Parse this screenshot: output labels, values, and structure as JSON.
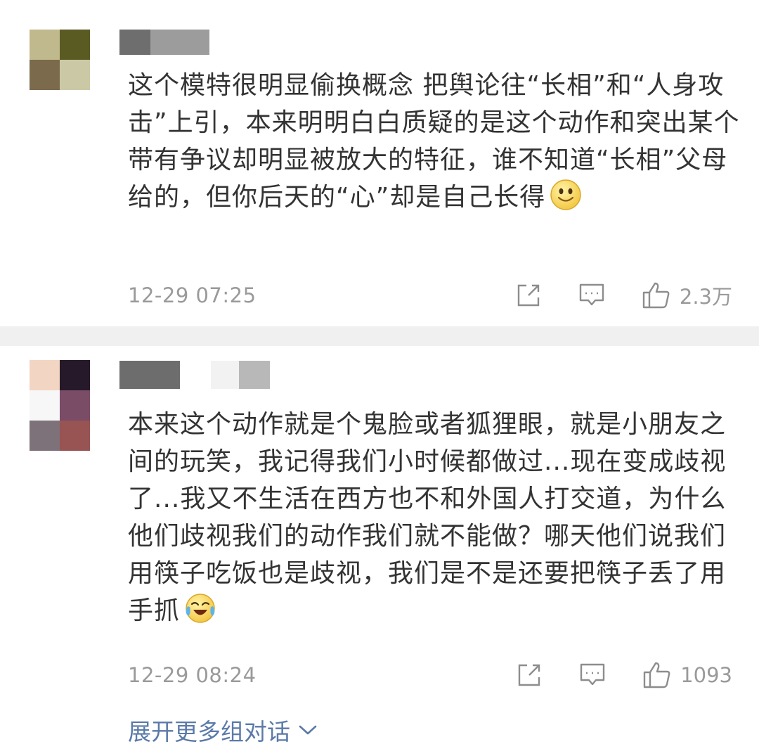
{
  "comments": [
    {
      "avatar_colors": [
        "#c1b98e",
        "#5a5a23",
        "#7b6a4c",
        "#cbc8a6"
      ],
      "name_colors": [
        "#6e6e6e",
        "#9c9c9c",
        "#ffffff",
        "#ffffff"
      ],
      "text": "这个模特很明显偷换概念 把舆论往“长相”和“人身攻击”上引，本来明明白白质疑的是这个动作和突出某个带有争议却明显被放大的特征，谁不知道“长相”父母给的，但你后天的“心”却是自己长得",
      "emoji": "smile-emoji",
      "time": "12-29 07:25",
      "likes": "2.3万"
    },
    {
      "avatar_colors": [
        "#f3d5c3",
        "#25192a",
        "#f7f7f7",
        "#7b4c66",
        "#7d7279",
        "#985453"
      ],
      "name_colors": [
        "#6d6d6d",
        "#ffffff",
        "#f2f2f2",
        "#b8b8b8"
      ],
      "text": "本来这个动作就是个鬼脸或者狐狸眼，就是小朋友之间的玩笑，我记得我们小时候都做过...现在变成歧视了...我又不生活在西方也不和外国人打交道，为什么他们歧视我们的动作我们就不能做？哪天他们说我们用筷子吃饭也是歧视，我们是不是还要把筷子丢了用手抓",
      "emoji": "laugh-cry-emoji",
      "time": "12-29 08:24",
      "likes": "1093"
    }
  ],
  "expand_label": "展开更多组对话",
  "colors": {
    "text": "#333333",
    "meta": "#9a9a9a",
    "link": "#5b7aa8",
    "separator": "#f0f0f0"
  }
}
